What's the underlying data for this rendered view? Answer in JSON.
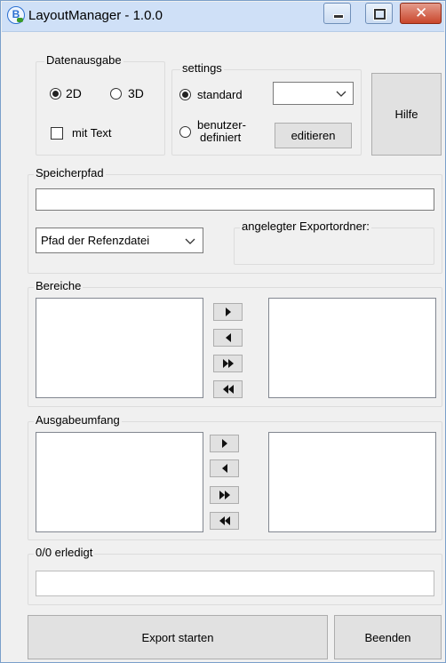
{
  "window": {
    "title": "LayoutManager - 1.0.0",
    "icon_letter": "B",
    "controls": [
      "minimize-icon",
      "maximize-icon",
      "close-icon"
    ],
    "close_color": "#c9462c"
  },
  "datenausgabe": {
    "legend": "Datenausgabe",
    "radio_2d": "2D",
    "radio_3d": "3D",
    "selected": "2D",
    "checkbox_label": "mit Text",
    "checkbox_checked": false
  },
  "settings": {
    "legend": "settings",
    "radio_standard": "standard",
    "radio_custom_line1": "benutzer-",
    "radio_custom_line2": "definiert",
    "selected": "standard",
    "dropdown_value": "",
    "edit_button": "editieren"
  },
  "help_button": "Hilfe",
  "speicherpfad": {
    "legend": "Speicherpfad",
    "path_value": "",
    "combo_value": "Pfad der Refenzdatei",
    "export_folder_legend": "angelegter Exportordner:"
  },
  "bereiche": {
    "legend": "Bereiche",
    "left_items": [],
    "right_items": [],
    "buttons": [
      "move-right-icon",
      "move-left-icon",
      "move-all-right-icon",
      "move-all-left-icon"
    ]
  },
  "ausgabeumfang": {
    "legend": "Ausgabeumfang",
    "left_items": [],
    "right_items": [],
    "buttons": [
      "move-right-icon",
      "move-left-icon",
      "move-all-right-icon",
      "move-all-left-icon"
    ]
  },
  "progress": {
    "legend": "0/0 erledigt",
    "completed": 0,
    "total": 0,
    "fraction": 0
  },
  "footer": {
    "export_button": "Export starten",
    "exit_button": "Beenden"
  }
}
